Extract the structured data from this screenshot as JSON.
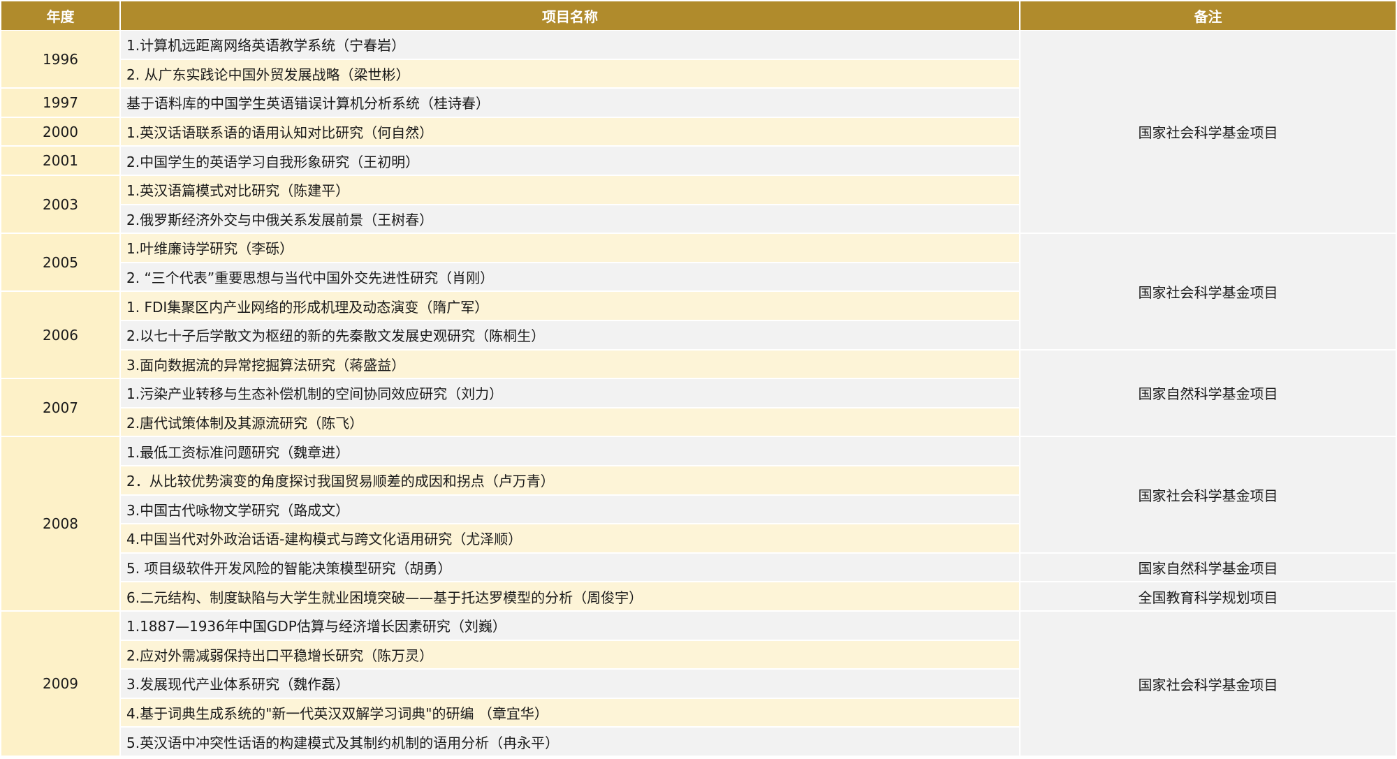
{
  "headers": {
    "year": "年度",
    "project": "项目名称",
    "note": "备注"
  },
  "rows": [
    "1.计算机远距离网络英语教学系统（宁春岩）",
    "2. 从广东实践论中国外贸发展战略（梁世彬）",
    "基于语料库的中国学生英语错误计算机分析系统（桂诗春）",
    "1.英汉话语联系语的语用认知对比研究（何自然）",
    "2.中国学生的英语学习自我形象研究（王初明）",
    "1.英汉语篇模式对比研究（陈建平）",
    "2.俄罗斯经济外交与中俄关系发展前景（王树春）",
    "1.叶维廉诗学研究（李砾）",
    "2. “三个代表”重要思想与当代中国外交先进性研究（肖刚）",
    "1. FDI集聚区内产业网络的形成机理及动态演变（隋广军）",
    "2.以七十子后学散文为枢纽的新的先秦散文发展史观研究（陈桐生）",
    "3.面向数据流的异常挖掘算法研究（蒋盛益）",
    "1.污染产业转移与生态补偿机制的空间协同效应研究（刘力）",
    "2.唐代试策体制及其源流研究（陈飞）",
    "1.最低工资标准问题研究（魏章进）",
    "2．从比较优势演变的角度探讨我国贸易顺差的成因和拐点（卢万青）",
    "3.中国古代咏物文学研究（路成文）",
    "4.中国当代对外政治话语-建构模式与跨文化语用研究（尤泽顺）",
    "5. 项目级软件开发风险的智能决策模型研究（胡勇）",
    "6.二元结构、制度缺陷与大学生就业困境突破——基于托达罗模型的分析（周俊宇）",
    "1.1887—1936年中国GDP估算与经济增长因素研究（刘巍）",
    "2.应对外需减弱保持出口平稳增长研究（陈万灵）",
    "3.发展现代产业体系研究（魏作磊）",
    "4.基于词典生成系统的\"新一代英汉双解学习词典\"的研编 （章宜华）",
    "5.英汉语中冲突性话语的构建模式及其制约机制的语用分析（冉永平）"
  ],
  "years": [
    {
      "label": "1996",
      "start": 0,
      "span": 2
    },
    {
      "label": "1997",
      "start": 2,
      "span": 1
    },
    {
      "label": "2000",
      "start": 3,
      "span": 1
    },
    {
      "label": "2001",
      "start": 4,
      "span": 1
    },
    {
      "label": "2003",
      "start": 5,
      "span": 2
    },
    {
      "label": "2005",
      "start": 7,
      "span": 2
    },
    {
      "label": "2006",
      "start": 9,
      "span": 3
    },
    {
      "label": "2007",
      "start": 12,
      "span": 2
    },
    {
      "label": "2008",
      "start": 14,
      "span": 6
    },
    {
      "label": "2009",
      "start": 20,
      "span": 5
    }
  ],
  "notes": [
    {
      "label": "国家社会科学基金项目",
      "start": 0,
      "span": 7
    },
    {
      "label": "国家社会科学基金项目",
      "start": 7,
      "span": 4
    },
    {
      "label": "国家自然科学基金项目",
      "start": 11,
      "span": 3
    },
    {
      "label": "国家社会科学基金项目",
      "start": 14,
      "span": 4
    },
    {
      "label": "国家自然科学基金项目",
      "start": 18,
      "span": 1
    },
    {
      "label": "全国教育科学规划项目",
      "start": 19,
      "span": 1
    },
    {
      "label": "国家社会科学基金项目",
      "start": 20,
      "span": 5
    }
  ],
  "colors": {
    "header": "#b08b2c",
    "year_fill": "#fdf1c8",
    "row_odd": "#f2f2f2",
    "row_even": "#fdf4d7"
  }
}
